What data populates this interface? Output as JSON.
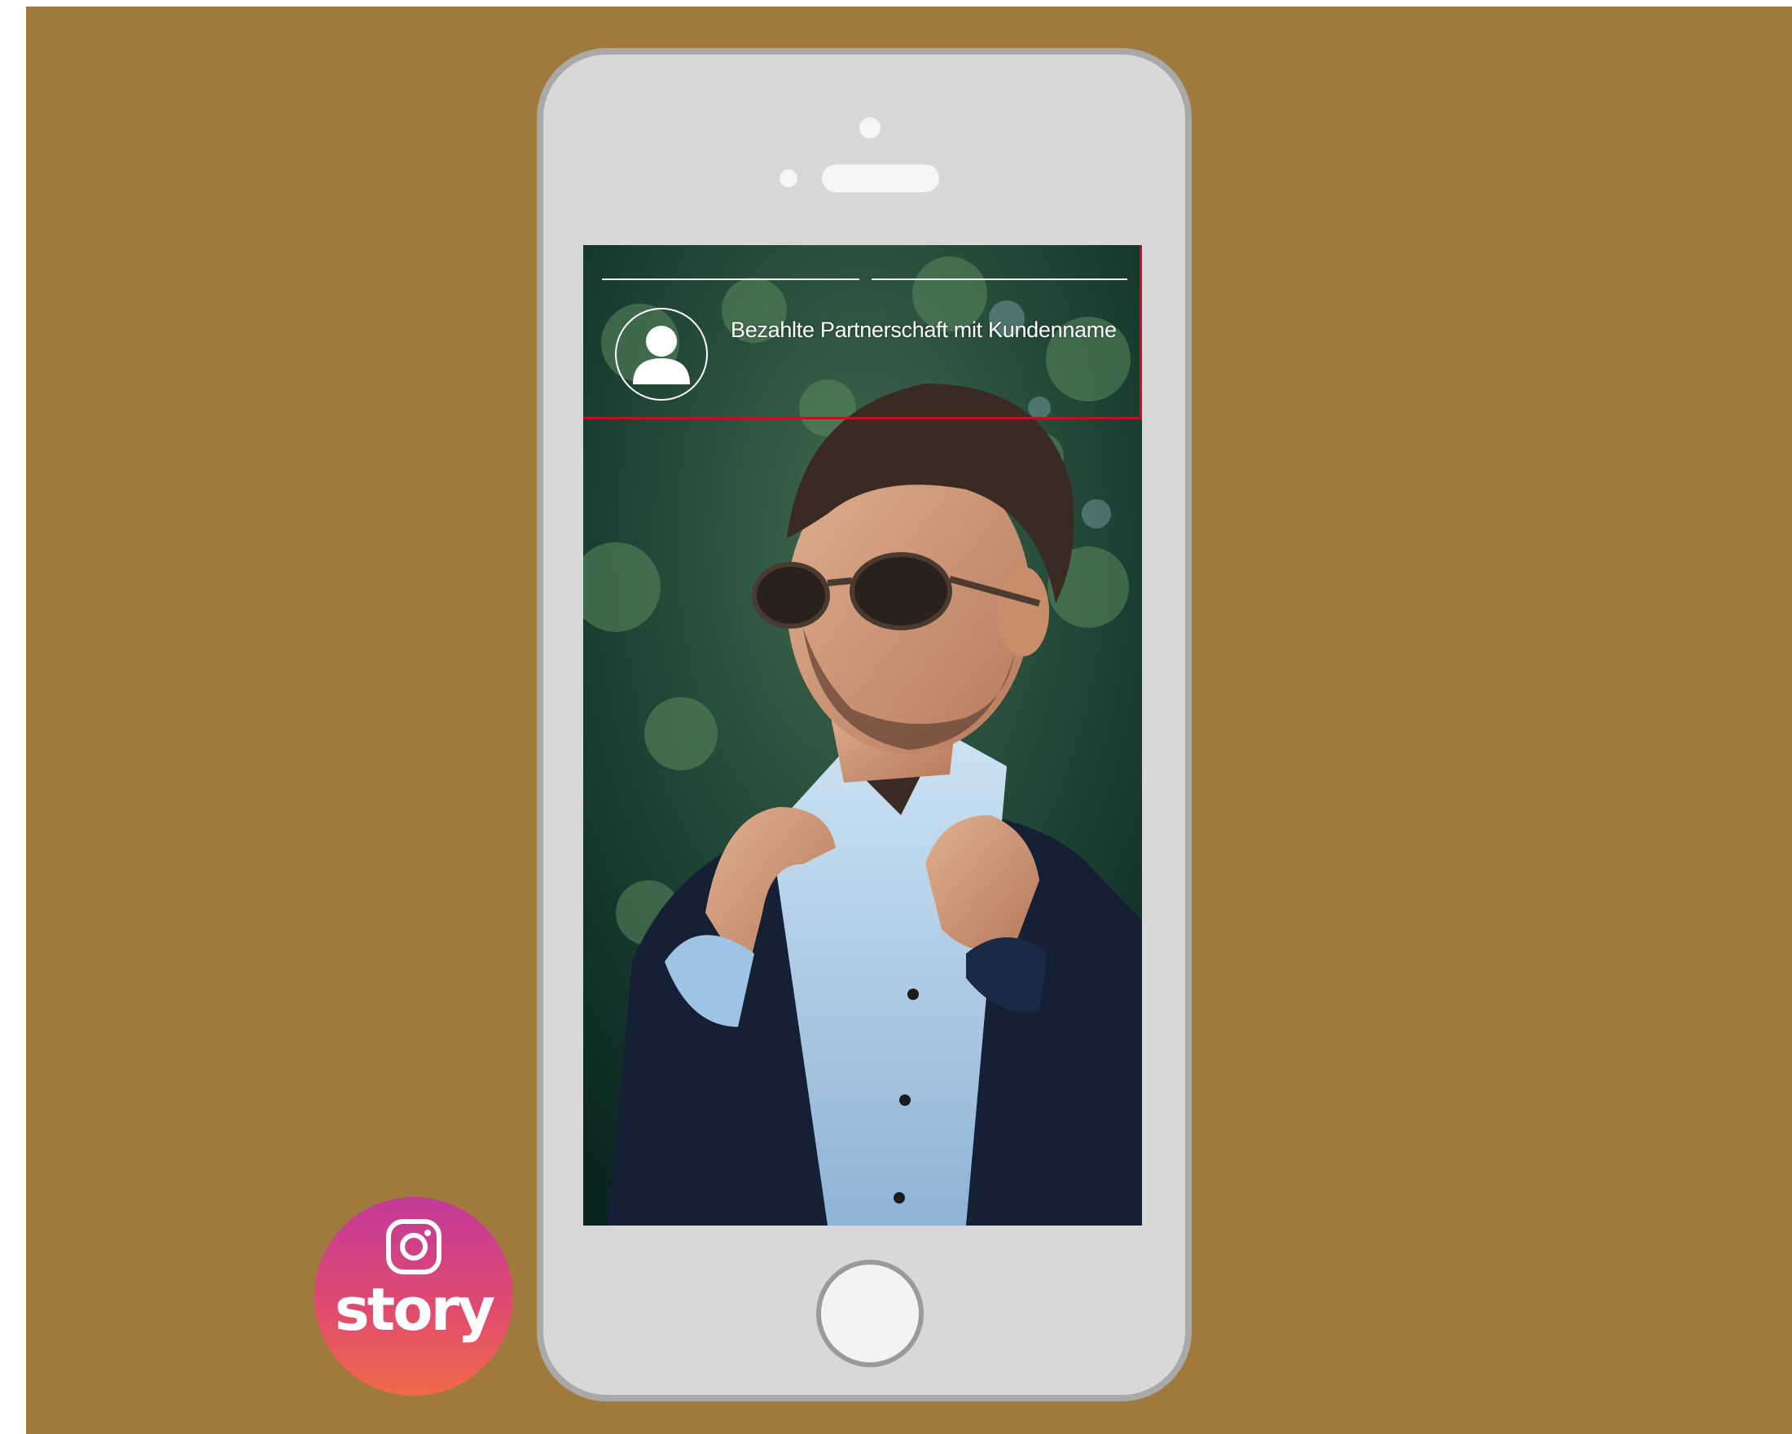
{
  "story": {
    "sponsor_label": "Bezahlte Partnerschaft mit Kundenname",
    "progress_segments": 2,
    "avatar_icon": "user-silhouette-icon"
  },
  "badge": {
    "icon": "instagram-icon",
    "label": "story"
  },
  "colors": {
    "background": "#a07a3c",
    "phone_body": "#d8d8d8",
    "phone_border": "#a9a9a9",
    "highlight_frame": "#c8101c",
    "badge_gradient_top": "#c23a9a",
    "badge_gradient_bottom": "#f26a4a"
  }
}
